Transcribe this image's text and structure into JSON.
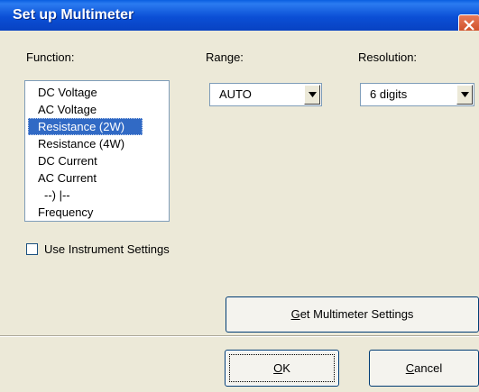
{
  "window": {
    "title": "Set up Multimeter"
  },
  "labels": {
    "function": "Function:",
    "range": "Range:",
    "resolution": "Resolution:"
  },
  "function_list": {
    "items": [
      "DC Voltage",
      "AC Voltage",
      "Resistance (2W)",
      "Resistance (4W)",
      "DC Current",
      "AC Current",
      "--) |--",
      "Frequency"
    ],
    "selected_index": 2
  },
  "range": {
    "value": "AUTO"
  },
  "resolution": {
    "value": "6 digits"
  },
  "use_instrument_settings": {
    "label": "Use Instrument Settings",
    "checked": false
  },
  "buttons": {
    "get_settings": {
      "mnemonic": "G",
      "rest": "et Multimeter Settings"
    },
    "ok": {
      "mnemonic": "O",
      "rest": "K"
    },
    "cancel": {
      "mnemonic": "C",
      "rest": "ancel"
    }
  },
  "colors": {
    "title_bar": "#0b4fd6",
    "selection": "#316ac5",
    "face": "#ece9d8",
    "close": "#c9461d"
  }
}
